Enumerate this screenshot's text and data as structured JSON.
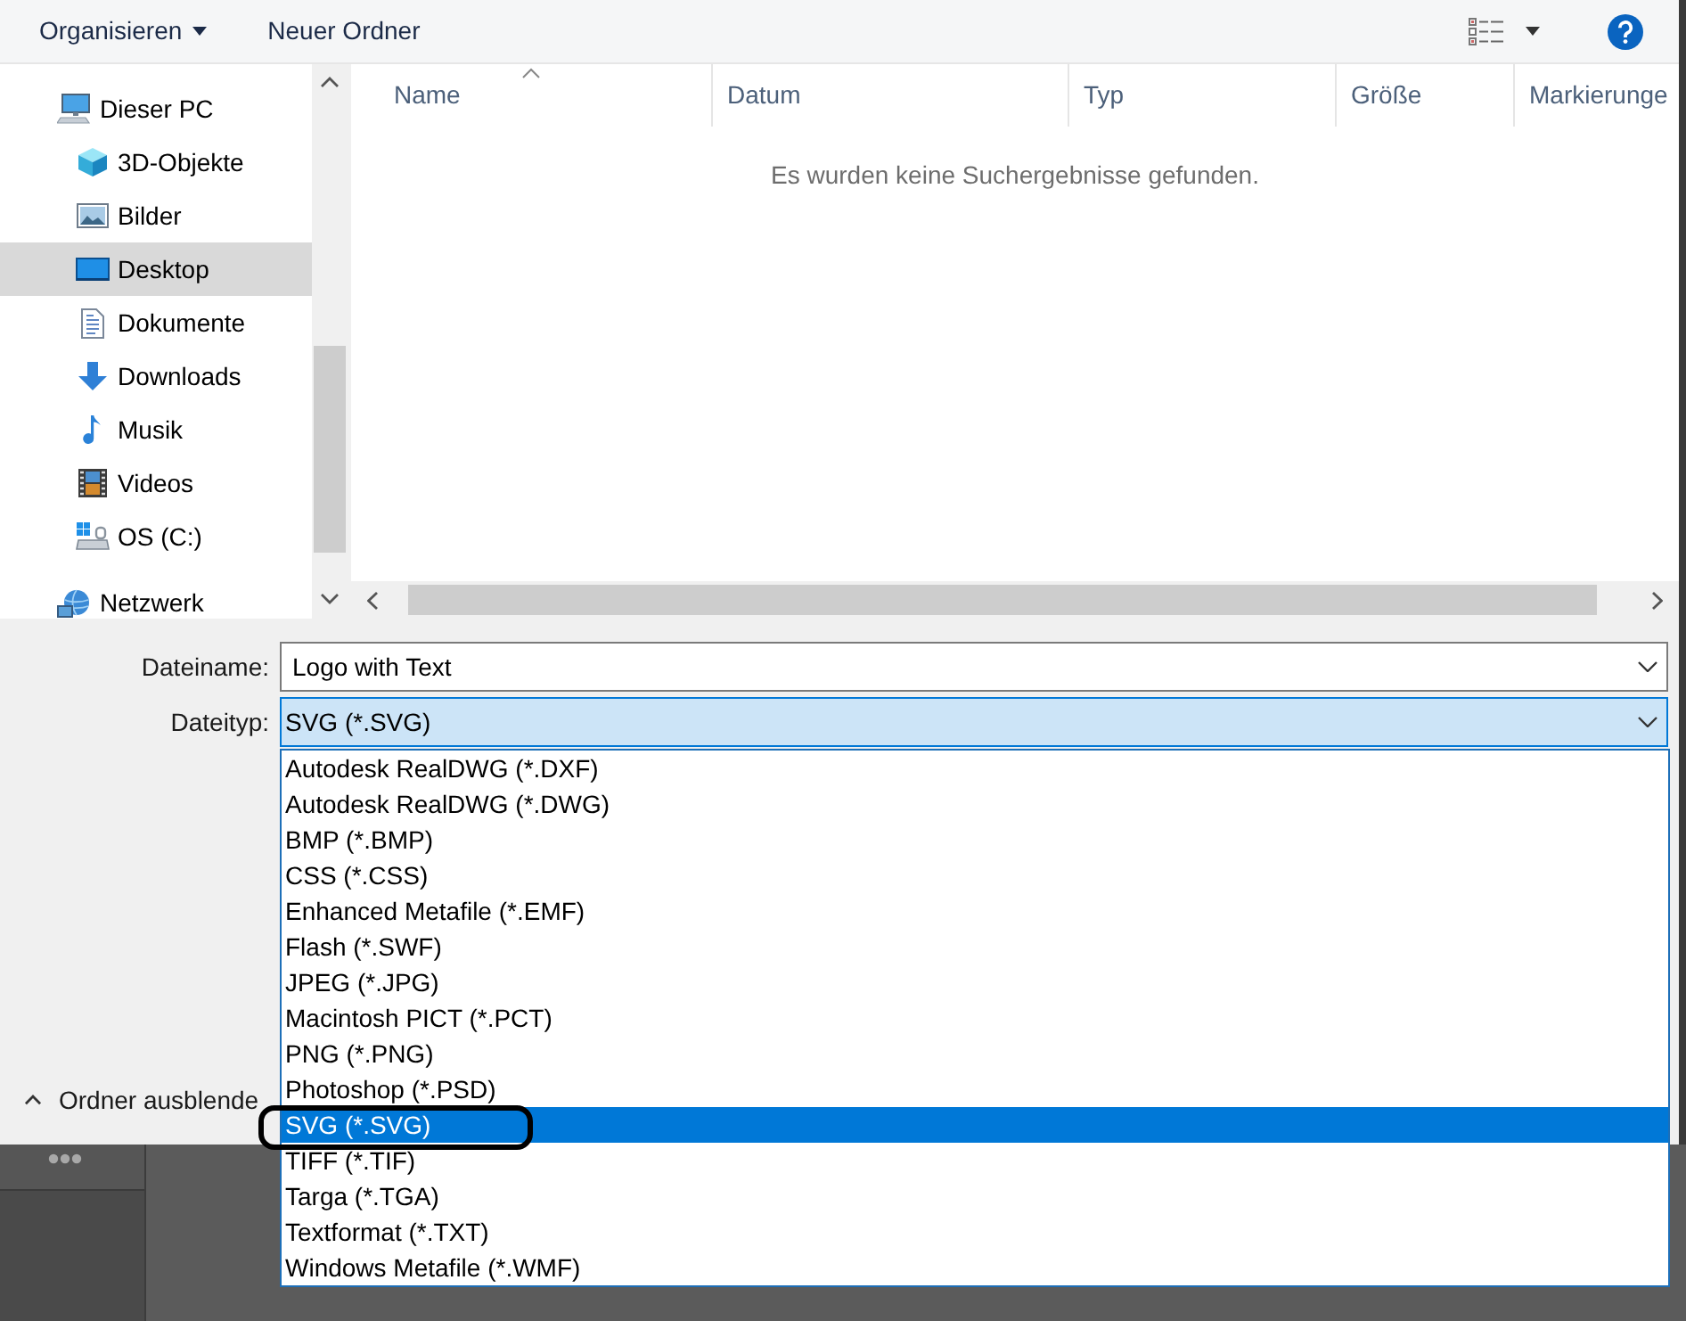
{
  "toolbar": {
    "menu": {
      "label": "Organisieren"
    },
    "new_folder": {
      "label": "Neuer Ordner"
    }
  },
  "sidebar": {
    "items": [
      {
        "label": "Dieser PC",
        "selected": false,
        "children": [
          {
            "label": "3D-Objekte",
            "selected": false
          },
          {
            "label": "Bilder",
            "selected": false
          },
          {
            "label": "Desktop",
            "selected": true
          },
          {
            "label": "Dokumente",
            "selected": false
          },
          {
            "label": "Downloads",
            "selected": false
          },
          {
            "label": "Musik",
            "selected": false
          },
          {
            "label": "Videos",
            "selected": false
          },
          {
            "label": "OS (C:)",
            "selected": false
          }
        ]
      },
      {
        "label": "Netzwerk",
        "selected": false
      }
    ]
  },
  "file_list": {
    "columns": [
      {
        "label": "Name",
        "sorted": true
      },
      {
        "label": "Datum",
        "sorted": false
      },
      {
        "label": "Typ",
        "sorted": false
      },
      {
        "label": "Größe",
        "sorted": false
      },
      {
        "label": "Markierunge",
        "sorted": false
      }
    ],
    "empty_message": "Es wurden keine Suchergebnisse gefunden."
  },
  "file_name": {
    "label": "Dateiname:",
    "value": "Logo with Text"
  },
  "file_type": {
    "label": "Dateityp:",
    "value": "SVG (*.SVG)",
    "focused": true,
    "expanded": true,
    "options": [
      {
        "label": "Autodesk RealDWG (*.DXF)",
        "selected": false,
        "circled": false
      },
      {
        "label": "Autodesk RealDWG (*.DWG)",
        "selected": false,
        "circled": false
      },
      {
        "label": "BMP (*.BMP)",
        "selected": false,
        "circled": false
      },
      {
        "label": "CSS (*.CSS)",
        "selected": false,
        "circled": false
      },
      {
        "label": "Enhanced Metafile (*.EMF)",
        "selected": false,
        "circled": false
      },
      {
        "label": "Flash (*.SWF)",
        "selected": false,
        "circled": false
      },
      {
        "label": "JPEG (*.JPG)",
        "selected": false,
        "circled": false
      },
      {
        "label": "Macintosh PICT (*.PCT)",
        "selected": false,
        "circled": false
      },
      {
        "label": "PNG (*.PNG)",
        "selected": false,
        "circled": false
      },
      {
        "label": "Photoshop (*.PSD)",
        "selected": false,
        "circled": false
      },
      {
        "label": "SVG (*.SVG)",
        "selected": true,
        "circled": true
      },
      {
        "label": "TIFF (*.TIF)",
        "selected": false,
        "circled": false
      },
      {
        "label": "Targa (*.TGA)",
        "selected": false,
        "circled": false
      },
      {
        "label": "Textformat (*.TXT)",
        "selected": false,
        "circled": false
      },
      {
        "label": "Windows Metafile (*.WMF)",
        "selected": false,
        "circled": false
      }
    ]
  },
  "hide_folders": {
    "label": "Ordner ausblende"
  }
}
